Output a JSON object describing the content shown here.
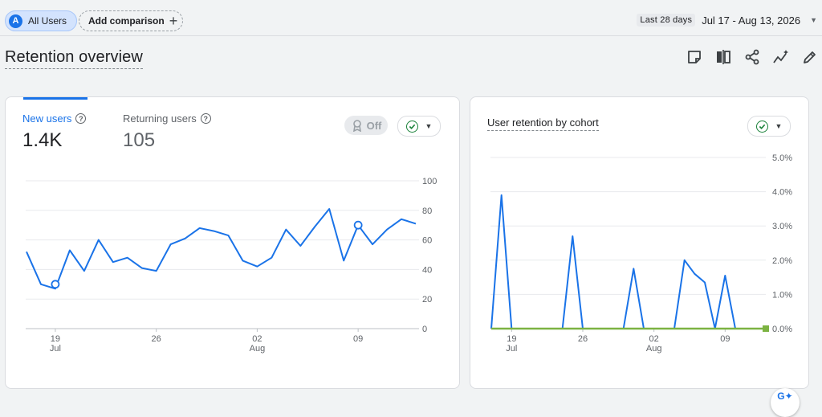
{
  "header": {
    "segment_chip": {
      "avatar_letter": "A",
      "label": "All Users"
    },
    "add_comparison": "Add comparison",
    "date_range": {
      "preset": "Last 28 days",
      "range": "Jul 17 - Aug 13, 2026"
    }
  },
  "page": {
    "title": "Retention overview",
    "toolbar_icons": [
      "note-icon",
      "compare-icon",
      "share-icon",
      "insights-icon",
      "edit-icon"
    ]
  },
  "left_card": {
    "metrics": [
      {
        "label": "New users",
        "value": "1.4K"
      },
      {
        "label": "Returning users",
        "value": "105"
      }
    ],
    "benchmark_toggle": "Off"
  },
  "right_card": {
    "title": "User retention by cohort"
  },
  "colors": {
    "accent": "#1a73e8",
    "line": "#1a73e8",
    "baseline": "#7cb342",
    "check": "#188038"
  },
  "chart_data": [
    {
      "type": "line",
      "title": "",
      "x": [
        "Jul 18",
        "Jul 19",
        "Jul 20",
        "Jul 21",
        "Jul 22",
        "Jul 23",
        "Jul 24",
        "Jul 25",
        "Jul 26",
        "Jul 27",
        "Jul 28",
        "Jul 29",
        "Jul 30",
        "Jul 31",
        "Aug 01",
        "Aug 02",
        "Aug 03",
        "Aug 04",
        "Aug 05",
        "Aug 06",
        "Aug 07",
        "Aug 08",
        "Aug 09",
        "Aug 10",
        "Aug 11",
        "Aug 12",
        "Aug 13"
      ],
      "series": [
        {
          "values": [
            52,
            30,
            27,
            53,
            39,
            60,
            45,
            48,
            41,
            39,
            57,
            61,
            68,
            66,
            63,
            46,
            42,
            48,
            67,
            56,
            69,
            81,
            46,
            70,
            57,
            67,
            74,
            71
          ]
        }
      ],
      "x_tick_labels": [
        {
          "label": "19",
          "sub": "Jul"
        },
        {
          "label": "26",
          "sub": ""
        },
        {
          "label": "02",
          "sub": "Aug"
        },
        {
          "label": "09",
          "sub": ""
        }
      ],
      "y_tick_labels": [
        "0",
        "20",
        "40",
        "60",
        "80",
        "100"
      ],
      "ylim": [
        0,
        100
      ],
      "grid": true,
      "markers": [
        {
          "x": "Jul 19",
          "y": 30
        },
        {
          "x": "Aug 09",
          "y": 70
        }
      ],
      "xlabel": "",
      "ylabel": ""
    },
    {
      "type": "line",
      "title": "User retention by cohort",
      "x": [
        "Jul 17",
        "Jul 18",
        "Jul 19",
        "Jul 20",
        "Jul 21",
        "Jul 22",
        "Jul 23",
        "Jul 24",
        "Jul 25",
        "Jul 26",
        "Jul 27",
        "Jul 28",
        "Jul 29",
        "Jul 30",
        "Jul 31",
        "Aug 01",
        "Aug 02",
        "Aug 03",
        "Aug 04",
        "Aug 05",
        "Aug 06",
        "Aug 07",
        "Aug 08",
        "Aug 09",
        "Aug 10",
        "Aug 11",
        "Aug 12",
        "Aug 13"
      ],
      "series": [
        {
          "values": [
            0,
            3.9,
            0,
            0,
            0,
            0,
            0,
            0,
            2.7,
            0,
            0,
            0,
            0,
            0,
            1.75,
            0,
            0,
            0,
            0,
            2.0,
            1.6,
            1.35,
            0,
            1.55,
            0,
            0,
            0,
            0
          ]
        },
        {
          "values": [
            0,
            0,
            0,
            0,
            0,
            0,
            0,
            0,
            0,
            0,
            0,
            0,
            0,
            0,
            0,
            0,
            0,
            0,
            0,
            0,
            0,
            0,
            0,
            0,
            0,
            0,
            0,
            0
          ]
        }
      ],
      "x_tick_labels": [
        {
          "label": "19",
          "sub": "Jul"
        },
        {
          "label": "26",
          "sub": ""
        },
        {
          "label": "02",
          "sub": "Aug"
        },
        {
          "label": "09",
          "sub": ""
        }
      ],
      "y_tick_labels": [
        "0.0%",
        "1.0%",
        "2.0%",
        "3.0%",
        "4.0%",
        "5.0%"
      ],
      "ylim": [
        0,
        5
      ],
      "grid": true,
      "xlabel": "",
      "ylabel": ""
    }
  ]
}
